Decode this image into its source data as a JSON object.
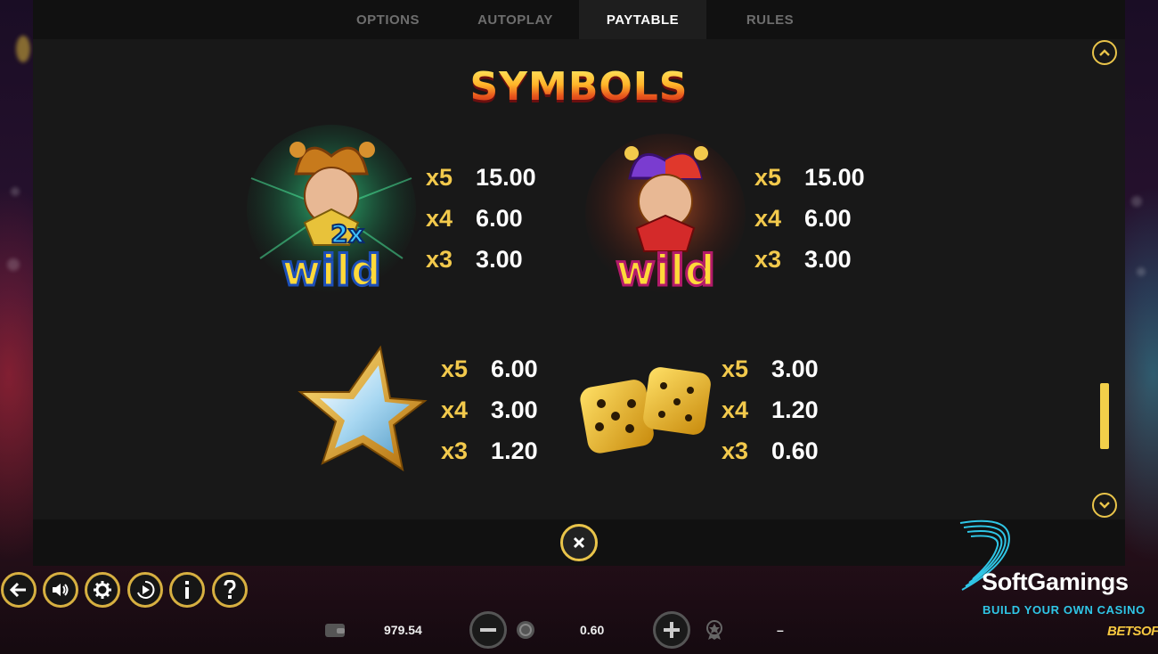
{
  "tabs": [
    {
      "label": "OPTIONS",
      "active": false
    },
    {
      "label": "AUTOPLAY",
      "active": false
    },
    {
      "label": "PAYTABLE",
      "active": true
    },
    {
      "label": "RULES",
      "active": false
    }
  ],
  "section_title": "SYMBOLS",
  "symbols": [
    {
      "name": "2x wild joker",
      "art_text": [
        "2x",
        "wild"
      ],
      "payouts": [
        {
          "mult": "x5",
          "value": "15.00"
        },
        {
          "mult": "x4",
          "value": "6.00"
        },
        {
          "mult": "x3",
          "value": "3.00"
        }
      ]
    },
    {
      "name": "wild joker",
      "art_text": [
        "wild"
      ],
      "payouts": [
        {
          "mult": "x5",
          "value": "15.00"
        },
        {
          "mult": "x4",
          "value": "6.00"
        },
        {
          "mult": "x3",
          "value": "3.00"
        }
      ]
    },
    {
      "name": "star",
      "payouts": [
        {
          "mult": "x5",
          "value": "6.00"
        },
        {
          "mult": "x4",
          "value": "3.00"
        },
        {
          "mult": "x3",
          "value": "1.20"
        }
      ]
    },
    {
      "name": "dice",
      "payouts": [
        {
          "mult": "x5",
          "value": "3.00"
        },
        {
          "mult": "x4",
          "value": "1.20"
        },
        {
          "mult": "x3",
          "value": "0.60"
        }
      ]
    }
  ],
  "scrollbar": {
    "position": 0.83
  },
  "controls": [
    "back-icon",
    "sound-icon",
    "settings-icon",
    "autoplay-icon",
    "info-icon",
    "help-icon"
  ],
  "bottom_bar": {
    "balance": "979.54",
    "bet": "0.60",
    "win": "–"
  },
  "brand": {
    "name": "SoftGamings",
    "tagline": "BUILD YOUR OWN CASINO",
    "provider": "BETSOFT"
  },
  "colors": {
    "accent": "#e9c44a",
    "multiplier": "#f2c94c",
    "panel": "#181818",
    "brand_tagline": "#2fc6e6"
  }
}
